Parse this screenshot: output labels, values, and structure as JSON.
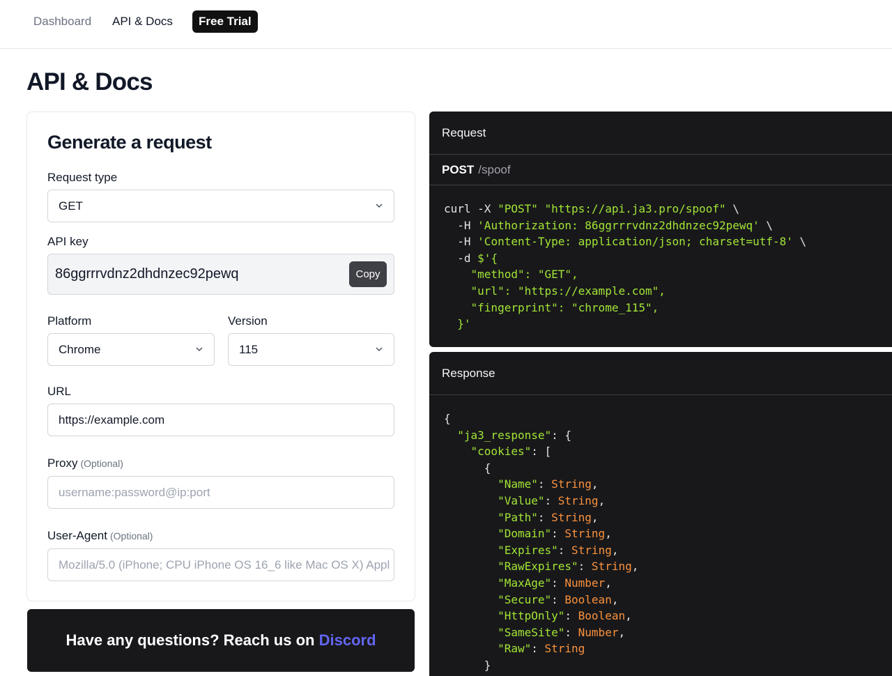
{
  "nav": {
    "dashboard": "Dashboard",
    "api_docs": "API & Docs",
    "free_trial": "Free Trial"
  },
  "page": {
    "title": "API & Docs"
  },
  "form": {
    "title": "Generate a request",
    "request_type": {
      "label": "Request type",
      "value": "GET"
    },
    "api_key": {
      "label": "API key",
      "value": "86ggrrrvdnz2dhdnzec92pewq",
      "copy_label": "Copy"
    },
    "platform": {
      "label": "Platform",
      "value": "Chrome"
    },
    "version": {
      "label": "Version",
      "value": "115"
    },
    "url": {
      "label": "URL",
      "value": "https://example.com"
    },
    "proxy": {
      "label": "Proxy",
      "optional": "(Optional)",
      "placeholder": "username:password@ip:port"
    },
    "user_agent": {
      "label": "User-Agent",
      "optional": "(Optional)",
      "placeholder": "Mozilla/5.0 (iPhone; CPU iPhone OS 16_6 like Mac OS X) Appl"
    }
  },
  "banner": {
    "text": "Have any questions? Reach us on ",
    "link": "Discord"
  },
  "request_panel": {
    "title": "Request",
    "method": "POST",
    "path": "/spoof",
    "lines": [
      [
        [
          "curl -X ",
          ""
        ],
        [
          "\"POST\"",
          "g"
        ],
        [
          " ",
          ""
        ],
        [
          "\"https://api.ja3.pro/spoof\"",
          "g"
        ],
        [
          " \\",
          ""
        ]
      ],
      [
        [
          "  -H ",
          ""
        ],
        [
          "'Authorization: 86ggrrrvdnz2dhdnzec92pewq'",
          "g"
        ],
        [
          " \\",
          ""
        ]
      ],
      [
        [
          "  -H ",
          ""
        ],
        [
          "'Content-Type: application/json; charset=utf-8'",
          "g"
        ],
        [
          " \\",
          ""
        ]
      ],
      [
        [
          "  -d ",
          ""
        ],
        [
          "$'{",
          "g"
        ]
      ],
      [
        [
          "    \"method\": \"GET\",",
          "g"
        ]
      ],
      [
        [
          "    \"url\": \"https://example.com\",",
          "g"
        ]
      ],
      [
        [
          "    \"fingerprint\": \"chrome_115\",",
          "g"
        ]
      ],
      [
        [
          "  }'",
          "g"
        ]
      ]
    ]
  },
  "response_panel": {
    "title": "Response",
    "lines": [
      [
        [
          "{",
          ""
        ]
      ],
      [
        [
          "  ",
          ""
        ],
        [
          "\"ja3_response\"",
          "g"
        ],
        [
          ": {",
          ""
        ]
      ],
      [
        [
          "    ",
          ""
        ],
        [
          "\"cookies\"",
          "g"
        ],
        [
          ": [",
          ""
        ]
      ],
      [
        [
          "      {",
          ""
        ]
      ],
      [
        [
          "        ",
          ""
        ],
        [
          "\"Name\"",
          "g"
        ],
        [
          ": ",
          ""
        ],
        [
          "String",
          "o"
        ],
        [
          ",",
          ""
        ]
      ],
      [
        [
          "        ",
          ""
        ],
        [
          "\"Value\"",
          "g"
        ],
        [
          ": ",
          ""
        ],
        [
          "String",
          "o"
        ],
        [
          ",",
          ""
        ]
      ],
      [
        [
          "        ",
          ""
        ],
        [
          "\"Path\"",
          "g"
        ],
        [
          ": ",
          ""
        ],
        [
          "String",
          "o"
        ],
        [
          ",",
          ""
        ]
      ],
      [
        [
          "        ",
          ""
        ],
        [
          "\"Domain\"",
          "g"
        ],
        [
          ": ",
          ""
        ],
        [
          "String",
          "o"
        ],
        [
          ",",
          ""
        ]
      ],
      [
        [
          "        ",
          ""
        ],
        [
          "\"Expires\"",
          "g"
        ],
        [
          ": ",
          ""
        ],
        [
          "String",
          "o"
        ],
        [
          ",",
          ""
        ]
      ],
      [
        [
          "        ",
          ""
        ],
        [
          "\"RawExpires\"",
          "g"
        ],
        [
          ": ",
          ""
        ],
        [
          "String",
          "o"
        ],
        [
          ",",
          ""
        ]
      ],
      [
        [
          "        ",
          ""
        ],
        [
          "\"MaxAge\"",
          "g"
        ],
        [
          ": ",
          ""
        ],
        [
          "Number",
          "o"
        ],
        [
          ",",
          ""
        ]
      ],
      [
        [
          "        ",
          ""
        ],
        [
          "\"Secure\"",
          "g"
        ],
        [
          ": ",
          ""
        ],
        [
          "Boolean",
          "o"
        ],
        [
          ",",
          ""
        ]
      ],
      [
        [
          "        ",
          ""
        ],
        [
          "\"HttpOnly\"",
          "g"
        ],
        [
          ": ",
          ""
        ],
        [
          "Boolean",
          "o"
        ],
        [
          ",",
          ""
        ]
      ],
      [
        [
          "        ",
          ""
        ],
        [
          "\"SameSite\"",
          "g"
        ],
        [
          ": ",
          ""
        ],
        [
          "Number",
          "o"
        ],
        [
          ",",
          ""
        ]
      ],
      [
        [
          "        ",
          ""
        ],
        [
          "\"Raw\"",
          "g"
        ],
        [
          ": ",
          ""
        ],
        [
          "String",
          "o"
        ]
      ],
      [
        [
          "      }",
          ""
        ]
      ]
    ]
  },
  "colors": {
    "code_string": "#a3e635",
    "code_type": "#fb923c",
    "discord_link": "#6366f1",
    "panel_bg": "#18181b"
  }
}
